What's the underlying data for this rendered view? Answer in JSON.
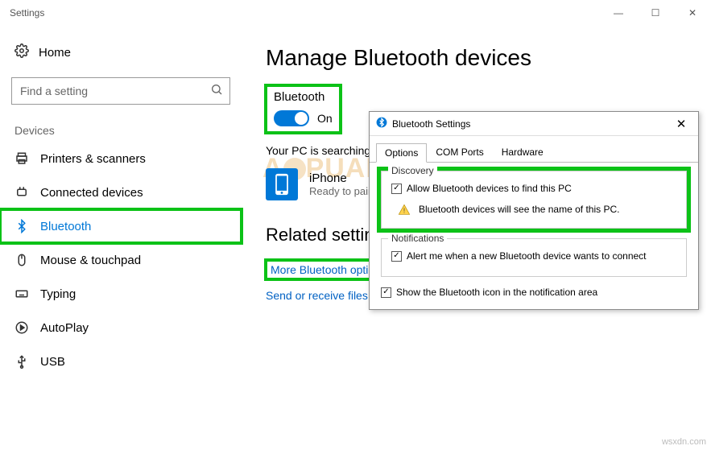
{
  "window": {
    "title": "Settings"
  },
  "win_controls": {
    "min": "—",
    "max": "☐",
    "close": "✕"
  },
  "nav": {
    "home": "Home",
    "search_placeholder": "Find a setting",
    "section": "Devices",
    "items": [
      {
        "icon": "printer",
        "label": "Printers & scanners"
      },
      {
        "icon": "plug",
        "label": "Connected devices"
      },
      {
        "icon": "bt",
        "label": "Bluetooth"
      },
      {
        "icon": "mouse",
        "label": "Mouse & touchpad"
      },
      {
        "icon": "kbd",
        "label": "Typing"
      },
      {
        "icon": "play",
        "label": "AutoPlay"
      },
      {
        "icon": "usb",
        "label": "USB"
      }
    ]
  },
  "main": {
    "title": "Manage Bluetooth devices",
    "bt_label": "Bluetooth",
    "bt_state": "On",
    "searching": "Your PC is searching for and can be discovered by Bluetooth devices.",
    "device": {
      "name": "iPhone",
      "status": "Ready to pair"
    },
    "related_heading": "Related settings",
    "link_more": "More Bluetooth options",
    "link_send": "Send or receive files via Bluetooth"
  },
  "dialog": {
    "title": "Bluetooth Settings",
    "tabs": [
      "Options",
      "COM Ports",
      "Hardware"
    ],
    "discovery": {
      "legend": "Discovery",
      "allow": "Allow Bluetooth devices to find this PC",
      "warn": "Bluetooth devices will see the name of this PC."
    },
    "notifications": {
      "legend": "Notifications",
      "alert": "Alert me when a new Bluetooth device wants to connect"
    },
    "tray": "Show the Bluetooth icon in the notification area"
  },
  "watermark": "wsxdn.com"
}
